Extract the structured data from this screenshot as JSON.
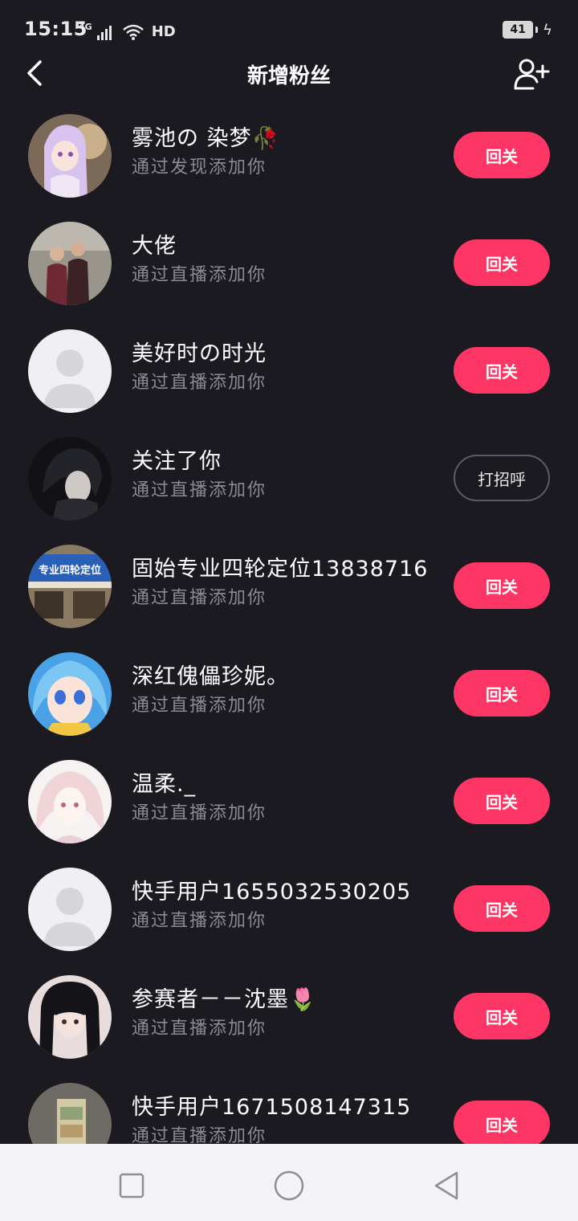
{
  "status_bar": {
    "time": "15:15",
    "network": "4G",
    "wifi_label": "HD",
    "battery": "41"
  },
  "header": {
    "title": "新增粉丝"
  },
  "subtitles": {
    "discover": "通过发现添加你",
    "live": "通过直播添加你"
  },
  "colors": {
    "background": "#1b1a20",
    "accent": "#fe3666",
    "secondary_text": "#8b8a91"
  },
  "fans": [
    {
      "name": "雾池の 染梦🥀",
      "source": "通过发现添加你",
      "action": "回关",
      "action_style": "primary",
      "avatar": "anime-girl-purple-hair"
    },
    {
      "name": "大佬",
      "source": "通过直播添加你",
      "action": "回关",
      "action_style": "primary",
      "avatar": "two-people-photo"
    },
    {
      "name": "美好时の时光",
      "source": "通过直播添加你",
      "action": "回关",
      "action_style": "primary",
      "avatar": "default-avatar"
    },
    {
      "name": "关注了你",
      "source": "通过直播添加你",
      "action": "打招呼",
      "action_style": "outline",
      "avatar": "dark-anime-character"
    },
    {
      "name": "固始专业四轮定位13838716",
      "source": "通过直播添加你",
      "action": "回关",
      "action_style": "primary",
      "avatar": "shop-sign-photo",
      "avatar_text": "专业四轮定位"
    },
    {
      "name": "深红傀儡珍妮。",
      "source": "通过直播添加你",
      "action": "回关",
      "action_style": "primary",
      "avatar": "anime-girl-blue-hair"
    },
    {
      "name": "温柔._",
      "source": "通过直播添加你",
      "action": "回关",
      "action_style": "primary",
      "avatar": "anime-girl-white-hair"
    },
    {
      "name": "快手用户1655032530205",
      "source": "通过直播添加你",
      "action": "回关",
      "action_style": "primary",
      "avatar": "default-avatar"
    },
    {
      "name": "参赛者－－沈墨🌷",
      "source": "通过直播添加你",
      "action": "回关",
      "action_style": "primary",
      "avatar": "anime-girl-black-hair"
    },
    {
      "name": "快手用户1671508147315",
      "source": "通过直播添加你",
      "action": "回关",
      "action_style": "primary",
      "avatar": "money-photo"
    }
  ]
}
